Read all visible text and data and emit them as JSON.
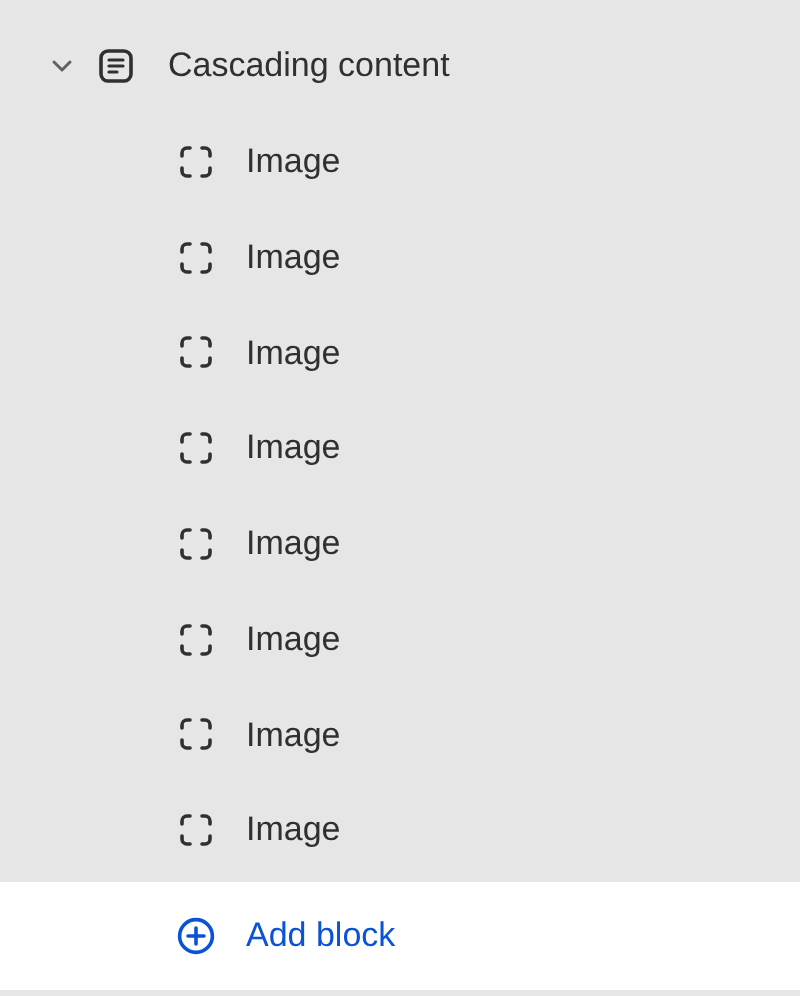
{
  "section": {
    "label": "Cascading content",
    "expanded": true,
    "blocks": [
      {
        "label": "Image"
      },
      {
        "label": "Image"
      },
      {
        "label": "Image"
      },
      {
        "label": "Image"
      },
      {
        "label": "Image"
      },
      {
        "label": "Image"
      },
      {
        "label": "Image"
      },
      {
        "label": "Image"
      }
    ],
    "add_button": {
      "label": "Add block"
    }
  }
}
